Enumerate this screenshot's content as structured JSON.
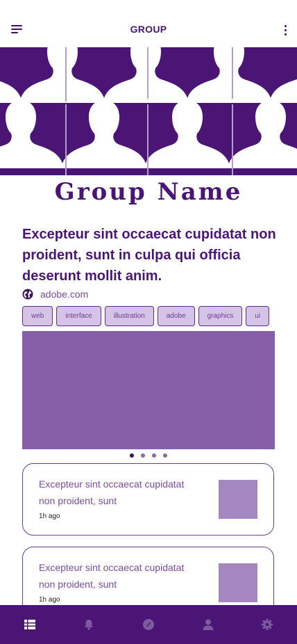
{
  "header": {
    "title": "GROUP",
    "menu_icon": "menu-icon",
    "more_icon": "more-vertical-icon"
  },
  "banner": {
    "description_icon": "people-silhouettes-pattern",
    "background": "#4a1574",
    "silhouette_color": "#ffffff"
  },
  "group": {
    "name": "Group Name",
    "headline": "Excepteur sint occaecat cupidatat non proident, sunt in culpa qui officia deserunt mollit anim.",
    "website": "adobe.com",
    "website_icon": "globe-icon"
  },
  "tags": [
    "web",
    "interface",
    "illustration",
    "adobe",
    "graphics",
    "ui"
  ],
  "carousel": {
    "color": "#875fa8",
    "page_count": 4,
    "active_index": 0
  },
  "cards": [
    {
      "text": "Excepteur sint occaecat cupidatat non proident, sunt",
      "time": "1h ago"
    },
    {
      "text": "Excepteur sint occaecat cupidatat non proident, sunt",
      "time": "1h ago"
    }
  ],
  "bottom_nav": {
    "items": [
      "feed-icon",
      "bell-icon",
      "compass-icon",
      "user-icon",
      "gear-icon"
    ],
    "active_index": 0
  },
  "colors": {
    "primary": "#4a1574",
    "accent": "#875fa8",
    "tag_bg": "#d5c4e6",
    "thumb": "#a487c0"
  }
}
